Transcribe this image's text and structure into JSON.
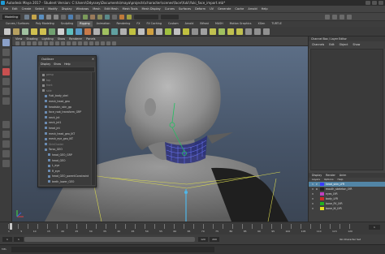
{
  "window": {
    "title": "Autodesk Maya 2017 - Student Version: C:\\Users\\Odyssey\\Documents\\maya\\projects\\character\\scenes\\face\\Yuki\\Yuki_face_import.mb*"
  },
  "menubar": {
    "items": [
      "File",
      "Edit",
      "Create",
      "Select",
      "Modify",
      "Display",
      "Windows",
      "Mesh",
      "Edit Mesh",
      "Mesh Tools",
      "Mesh Display",
      "Curves",
      "Surfaces",
      "Deform",
      "UV",
      "Generate",
      "Cache",
      "Arnold",
      "Help"
    ]
  },
  "statusline": {
    "mode": "Modeling"
  },
  "shelf": {
    "tabs": [
      "Curves / Surfaces",
      "Poly Modeling",
      "Sculpting",
      "Rigging",
      "Animation",
      "Rendering",
      "FX",
      "FX Caching",
      "Custom",
      "Arnold",
      "Bifrost",
      "MASH",
      "Motion Graphics",
      "XGen",
      "TURTLE"
    ],
    "active_tab": "Rigging"
  },
  "panel": {
    "menus": [
      "View",
      "Shading",
      "Lighting",
      "Show",
      "Renderer",
      "Panels"
    ]
  },
  "outliner": {
    "title": "Outliner",
    "menus": [
      "Display",
      "Show",
      "Help"
    ],
    "rows": [
      {
        "label": "persp",
        "state": "dim"
      },
      {
        "label": "top",
        "state": "dim"
      },
      {
        "label": "front",
        "state": "dim"
      },
      {
        "label": "side",
        "state": "dim"
      },
      {
        "label": "Yuki_body_skel",
        "state": ""
      },
      {
        "label": "mesh_head_geo",
        "state": ""
      },
      {
        "label": "headskin_skin_gp",
        "state": ""
      },
      {
        "label": "face_root_transform_GRP",
        "state": ""
      },
      {
        "label": "neck_jnt",
        "state": ""
      },
      {
        "label": "neck_jnt1",
        "state": ""
      },
      {
        "label": "head_jnt",
        "state": ""
      },
      {
        "label": "mesh_head_geo_IKT",
        "state": ""
      },
      {
        "label": "mesh_eye_geo_IKT",
        "state": ""
      },
      {
        "label": "SkinCluster",
        "state": "dim"
      },
      {
        "label": "Torso_GEO",
        "state": ""
      },
      {
        "label": "head_GEO_GRP",
        "state": ""
      },
      {
        "label": "head_GEO",
        "state": ""
      },
      {
        "label": "L_eye",
        "state": ""
      },
      {
        "label": "R_eye",
        "state": ""
      },
      {
        "label": "head_GEO_parentConstraint",
        "state": ""
      },
      {
        "label": "teeth_lower_GEO",
        "state": ""
      },
      {
        "label": "defaultLightSet",
        "state": ""
      },
      {
        "label": "defaultObjectSet",
        "state": ""
      }
    ]
  },
  "rightpanel": {
    "tabs": [
      "Channel Box / Layer Editor"
    ],
    "upper_menus": [
      "Channels",
      "Edit",
      "Object",
      "Show"
    ],
    "layer_tabs": [
      "Display",
      "Render",
      "Anim"
    ],
    "layer_menus": [
      "Layers",
      "Options",
      "Help"
    ],
    "layers": [
      {
        "v": "V",
        "p": "P",
        "name": "head_skin_LYR",
        "color": "#3a3aff",
        "selected": true
      },
      {
        "v": "V",
        "p": "R",
        "name": "mouth_skeleton_LYR",
        "color": "#222222",
        "selected": false
      },
      {
        "v": "V",
        "p": "",
        "name": "eyes_LYR",
        "color": "#c040c0",
        "selected": false
      },
      {
        "v": "V",
        "p": "",
        "name": "body_LYR",
        "color": "#cc2a2a",
        "selected": false
      },
      {
        "v": "V",
        "p": "",
        "name": "bone_FK_LYR",
        "color": "#20b020",
        "selected": false
      },
      {
        "v": "V",
        "p": "",
        "name": "bone_IK_LYR",
        "color": "#e0e020",
        "selected": false
      }
    ]
  },
  "timeslider": {
    "ticks": [
      "1",
      "5",
      "10",
      "15",
      "20",
      "25",
      "30",
      "35",
      "40",
      "45",
      "50",
      "55",
      "60",
      "65",
      "70",
      "75",
      "80",
      "85",
      "90",
      "95",
      "100",
      "105",
      "110",
      "115",
      "120"
    ],
    "current_frame": "1"
  },
  "rangeslider": {
    "start": "1",
    "range_start": "1",
    "range_end": "120",
    "end": "200",
    "label": "No Character Set"
  },
  "cmdline": {
    "lang": "MEL"
  }
}
